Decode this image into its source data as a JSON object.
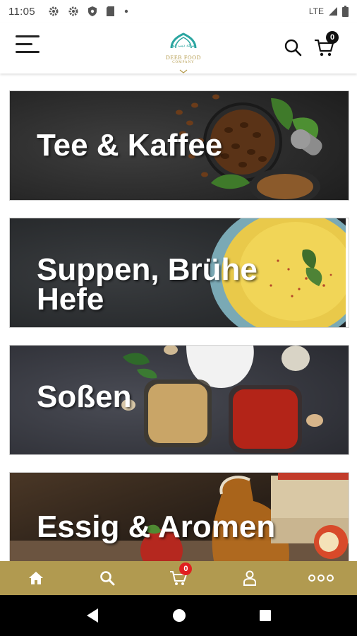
{
  "status_bar": {
    "time": "11:05",
    "network": "LTE",
    "icons": [
      "settings-icon",
      "settings-icon",
      "shield-icon",
      "sim-card-icon",
      "dot-icon"
    ]
  },
  "header": {
    "menu_icon": "hamburger-menu-icon",
    "logo": {
      "text": "DEEB FOOD",
      "sub": "COMPANY",
      "color": "#b49a4a"
    },
    "search_icon": "search-icon",
    "cart_icon": "cart-icon",
    "cart_count": "0"
  },
  "categories": [
    {
      "title": "Tee & Kaffee",
      "theme": "coffee"
    },
    {
      "title": "Suppen, Brühe\nHefe",
      "theme": "soup"
    },
    {
      "title": "Soßen",
      "theme": "sauces"
    },
    {
      "title": "Essig & Aromen",
      "theme": "vinegar"
    }
  ],
  "bottom_nav": {
    "background": "#b19a50",
    "items": [
      {
        "icon": "home-icon"
      },
      {
        "icon": "search-icon"
      },
      {
        "icon": "cart-icon",
        "badge": "0"
      },
      {
        "icon": "user-icon"
      },
      {
        "icon": "more-icon"
      }
    ]
  },
  "system_nav": {
    "icons": [
      "back-icon",
      "home-circle-icon",
      "recents-icon"
    ]
  }
}
